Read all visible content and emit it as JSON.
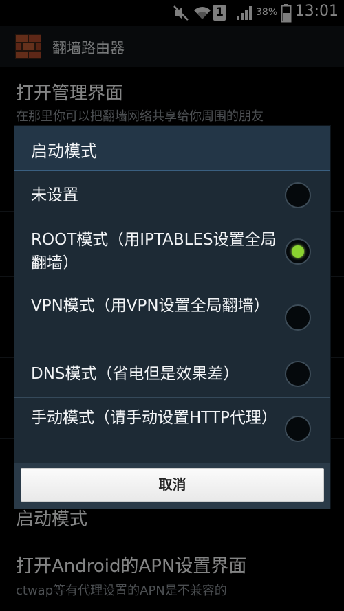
{
  "status_bar": {
    "icons": [
      "mute-icon",
      "wifi-icon",
      "sim-1-icon",
      "signal-icon",
      "battery-icon"
    ],
    "sim_label": "1",
    "battery_percent": "38%",
    "time": "13:01"
  },
  "action_bar": {
    "app_icon": "brick-wall-icon",
    "title": "翻墙路由器"
  },
  "background_list": {
    "items": [
      {
        "title": "打开管理界面",
        "subtitle": "在那里你可以把翻墙网络共享给你周围的朋友"
      },
      {
        "title": "启动模式",
        "subtitle": ""
      },
      {
        "title": "打开Android的APN设置界面",
        "subtitle": "ctwap等有代理设置的APN是不兼容的"
      }
    ]
  },
  "dialog": {
    "title": "启动模式",
    "options": [
      {
        "label": "未设置",
        "checked": false
      },
      {
        "label": "ROOT模式（用IPTABLES设置全局翻墙）",
        "checked": true
      },
      {
        "label": "VPN模式（用VPN设置全局翻墙）",
        "checked": false
      },
      {
        "label": "DNS模式（省电但是效果差）",
        "checked": false
      },
      {
        "label": "手动模式（请手动设置HTTP代理）",
        "checked": false
      }
    ],
    "cancel_label": "取消"
  }
}
